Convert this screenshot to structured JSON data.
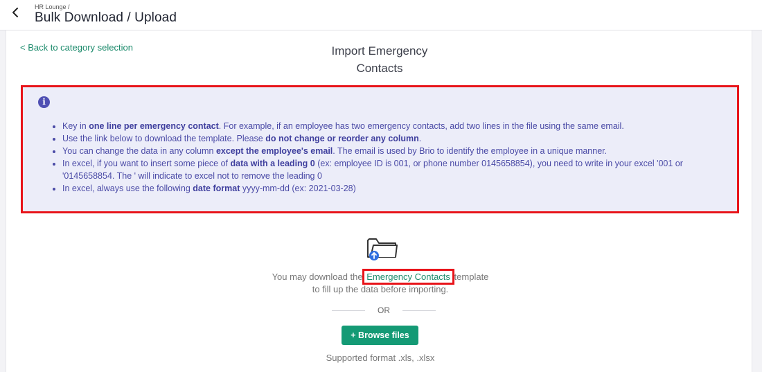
{
  "header": {
    "breadcrumb": "HR Lounge /",
    "title": "Bulk Download / Upload"
  },
  "main": {
    "back_link": "< Back to category selection",
    "title_line1": "Import Emergency",
    "title_line2": "Contacts",
    "info": {
      "items": [
        {
          "pre": "Key in ",
          "bold": "one line per emergency contact",
          "post": ". For example, if an employee has two emergency contacts, add two lines in the file using the same email."
        },
        {
          "pre": "Use the link below to download the template. Please ",
          "bold": "do not change or reorder any column",
          "post": "."
        },
        {
          "pre": "You can change the data in any column ",
          "bold": "except the employee's email",
          "post": ". The email is used by Brio to identify the employee in a unique manner."
        },
        {
          "pre": "In excel, if you want to insert some piece of ",
          "bold": "data with a leading 0",
          "post": " (ex: employee ID is 001, or phone number 0145658854), you need to write in your excel '001 or '0145658854. The ' will indicate to excel not to remove the leading 0"
        },
        {
          "pre": "In excel, always use the following ",
          "bold": "date format",
          "post": " yyyy-mm-dd (ex: 2021-03-28)"
        }
      ]
    },
    "upload": {
      "download_pre": "You may download the",
      "template_link": "Emergency Contacts",
      "download_post": "template",
      "download_line2": "to fill up the data before importing.",
      "or_label": "OR",
      "browse_label": "+ Browse files",
      "formats": "Supported format .xls, .xlsx"
    }
  },
  "colors": {
    "accent_green": "#149a75",
    "link_green": "#1b8a6b",
    "info_bg": "#ecedf9",
    "info_text": "#4a4aa6",
    "highlight_red": "#e8141a"
  }
}
